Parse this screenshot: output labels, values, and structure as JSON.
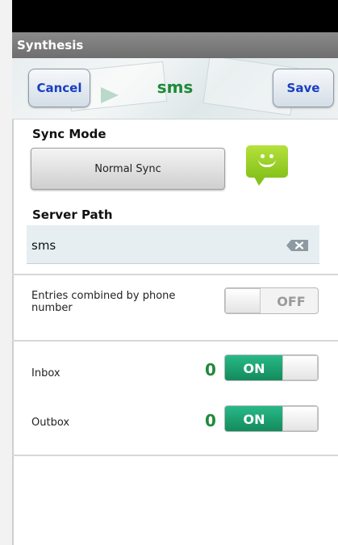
{
  "title_bar": {
    "title": "Synthesis"
  },
  "header": {
    "cancel_label": "Cancel",
    "title": "sms",
    "save_label": "Save"
  },
  "sync_mode": {
    "label": "Sync Mode",
    "button_label": "Normal Sync",
    "icon": "sms-smiley-icon"
  },
  "server_path": {
    "label": "Server Path",
    "value": "sms"
  },
  "entries_combined": {
    "label": "Entries combined by phone number",
    "toggle_state": "OFF"
  },
  "inbox": {
    "label": "Inbox",
    "count": "0",
    "toggle_state": "ON"
  },
  "outbox": {
    "label": "Outbox",
    "count": "0",
    "toggle_state": "ON"
  },
  "colors": {
    "accent_green": "#1f8a3a",
    "toggle_on": "#1aa06e",
    "button_text_blue": "#1840c0",
    "title_bar": "#7a7a7a"
  }
}
